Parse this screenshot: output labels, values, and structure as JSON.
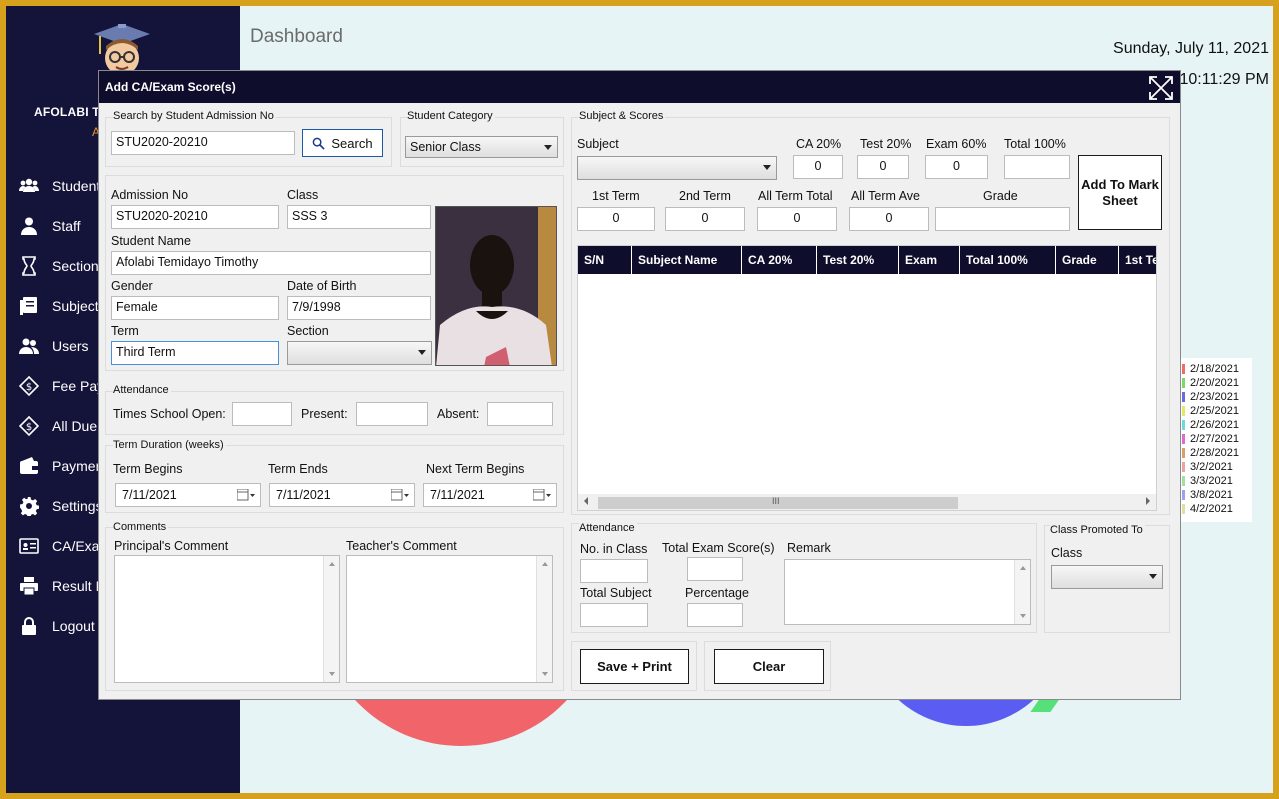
{
  "app": {
    "user_name": "AFOLABI T",
    "user_role": "A",
    "page_title": "Dashboard",
    "date": "Sunday, July 11, 2021",
    "time": "10:11:29 PM"
  },
  "sidebar": {
    "items": [
      {
        "label": "Student",
        "icon": "students-icon"
      },
      {
        "label": "Staff",
        "icon": "staff-icon"
      },
      {
        "label": "Section",
        "icon": "hourglass-icon"
      },
      {
        "label": "Subject",
        "icon": "subject-icon"
      },
      {
        "label": "Users",
        "icon": "users-icon"
      },
      {
        "label": "Fee Pay",
        "icon": "fee-icon"
      },
      {
        "label": "All Due",
        "icon": "due-icon"
      },
      {
        "label": "Paymen",
        "icon": "wallet-icon"
      },
      {
        "label": "Settings",
        "icon": "gear-icon"
      },
      {
        "label": "CA/Exa",
        "icon": "id-card-icon"
      },
      {
        "label": "Result M",
        "icon": "printer-icon"
      },
      {
        "label": "Logout",
        "icon": "lock-icon"
      }
    ]
  },
  "legend_behind": {
    "dates": [
      "2/18/2021",
      "2/20/2021",
      "2/23/2021",
      "2/25/2021",
      "2/26/2021",
      "2/27/2021",
      "2/28/2021",
      "3/2/2021",
      "3/3/2021",
      "3/8/2021",
      "4/2/2021"
    ],
    "colors": [
      "#f06a6a",
      "#7ad96a",
      "#6a6ae0",
      "#e6e66a",
      "#6ad9e0",
      "#e06ad0",
      "#d9a06a",
      "#f0a0a0",
      "#a0e0a0",
      "#a0a0f0",
      "#e0e0a0"
    ]
  },
  "dialog": {
    "title": "Add CA/Exam Score(s)",
    "search": {
      "group_label": "Search by Student Admission No",
      "value": "STU2020-20210",
      "button_label": "Search"
    },
    "category": {
      "group_label": "Student Category",
      "value": "Senior Class"
    },
    "student": {
      "admission_label": "Admission No",
      "admission_value": "STU2020-20210",
      "class_label": "Class",
      "class_value": "SSS 3",
      "name_label": "Student Name",
      "name_value": "Afolabi Temidayo Timothy",
      "gender_label": "Gender",
      "gender_value": "Female",
      "dob_label": "Date of Birth",
      "dob_value": "7/9/1998",
      "term_label": "Term",
      "term_value": "Third Term",
      "section_label": "Section",
      "section_value": ""
    },
    "attendance": {
      "group_label": "Attendance",
      "times_open_label": "Times School Open:",
      "present_label": "Present:",
      "absent_label": "Absent:"
    },
    "term_duration": {
      "group_label": "Term Duration (weeks)",
      "begins_label": "Term Begins",
      "begins_value": "7/11/2021",
      "ends_label": "Term Ends",
      "ends_value": "7/11/2021",
      "next_label": "Next Term Begins",
      "next_value": "7/11/2021"
    },
    "comments": {
      "group_label": "Comments",
      "principal_label": "Principal's Comment",
      "teacher_label": "Teacher's Comment"
    },
    "scores": {
      "group_label": "Subject & Scores",
      "subject_label": "Subject",
      "ca_label": "CA 20%",
      "ca_value": "0",
      "test_label": "Test 20%",
      "test_value": "0",
      "exam_label": "Exam 60%",
      "exam_value": "0",
      "total_label": "Total 100%",
      "total_value": "",
      "first_term_label": "1st Term",
      "first_term_value": "0",
      "second_term_label": "2nd Term",
      "second_term_value": "0",
      "all_total_label": "All Term Total",
      "all_total_value": "0",
      "all_ave_label": "All Term Ave",
      "all_ave_value": "0",
      "grade_label": "Grade",
      "grade_value": "",
      "add_button_label": "Add To Mark Sheet"
    },
    "grid": {
      "columns": [
        "S/N",
        "Subject Name",
        "CA 20%",
        "Test 20%",
        "Exam",
        "Total 100%",
        "Grade",
        "1st Te"
      ],
      "scroll_grip": "III"
    },
    "summary": {
      "group_label": "Attendance",
      "no_in_class_label": "No. in Class",
      "total_exam_label": "Total Exam Score(s)",
      "remark_label": "Remark",
      "total_subject_label": "Total Subject",
      "percentage_label": "Percentage"
    },
    "promotion": {
      "group_label": "Class Promoted To",
      "class_label": "Class"
    },
    "actions": {
      "save_print_label": "Save + Print",
      "clear_label": "Clear"
    }
  }
}
